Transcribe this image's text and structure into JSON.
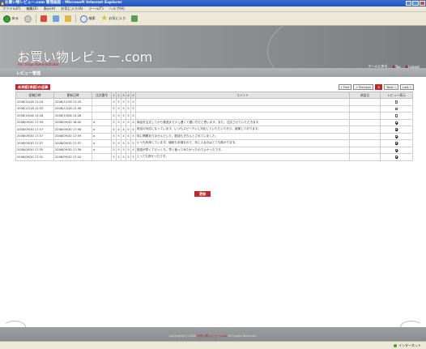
{
  "window": {
    "title": "お買い物レビュー.com 管理画面 - Microsoft Internet Explorer"
  },
  "menu": [
    "ファイル(F)",
    "編集(E)",
    "表示(V)",
    "お気に入り(A)",
    "ツール(T)",
    "ヘルプ(H)"
  ],
  "toolbar": {
    "back_label": "戻る",
    "search_label": "検索",
    "favorites_label": "お気に入り"
  },
  "site": {
    "name": "お買い物レビュー.com",
    "sub": "For Shop Administrator"
  },
  "nav": {
    "home_label": "ホームに戻る",
    "top_label": "Top",
    "logout_label": "Logout"
  },
  "section": {
    "title": "レビュー管理"
  },
  "actions": {
    "subtitle": "未承認(承認)の返事",
    "submit_label": "更新"
  },
  "pager": {
    "first": "« First",
    "prev": "« Previous",
    "current": "1",
    "next": "Next »",
    "last": "Last »"
  },
  "table": {
    "headers": [
      "投稿日時",
      "更新日時",
      "注文番号",
      "1",
      "2",
      "3",
      "4",
      "5",
      "コメント",
      "承認日",
      "レビュー表示"
    ],
    "rows": [
      {
        "posted": "2008/12/26 11:16",
        "updated": "2008/12/26 11:20",
        "order": "",
        "r1": "5",
        "r2": "5",
        "r3": "5",
        "r4": "5",
        "r5": "5",
        "comment": "",
        "approved": "",
        "show": false
      },
      {
        "posted": "2008/12/18 12:52",
        "updated": "2008/12/18 12:56",
        "order": "",
        "r1": "5",
        "r2": "5",
        "r3": "5",
        "r4": "5",
        "r5": "5",
        "comment": "",
        "approved": "",
        "show": false
      },
      {
        "posted": "2008/10/08 13:28",
        "updated": "2008/10/08 13:28",
        "order": "",
        "r1": "5",
        "r2": "5",
        "r3": "5",
        "r4": "5",
        "r5": "5",
        "comment": "",
        "approved": "",
        "show": false
      },
      {
        "posted": "2008/09/30 17:59",
        "updated": "2008/09/30 18:00",
        "order": "a",
        "r1": "5",
        "r2": "5",
        "r3": "5",
        "r4": "5",
        "r5": "4",
        "comment": "商品を注文してから発送まで少し遅くて遅い方だと思います。また、注文させていただきます。",
        "approved": "",
        "show": true
      },
      {
        "posted": "2008/09/30 17:57",
        "updated": "2008/09/30 17:58",
        "order": "a",
        "r1": "4",
        "r2": "4",
        "r3": "4",
        "r4": "5",
        "r5": "4",
        "comment": "来店の対応になっています。いつもスピーディに対応していただいており、感謝しております。",
        "approved": "",
        "show": true
      },
      {
        "posted": "2008/09/30 17:57",
        "updated": "2008/09/30 17:59",
        "order": "a",
        "r1": "5",
        "r2": "5",
        "r3": "4",
        "r4": "4",
        "r5": "5",
        "comment": "特に問題ありませんでした。配送もきちんとされていました。",
        "approved": "",
        "show": true
      },
      {
        "posted": "2008/09/30 17:57",
        "updated": "2008/09/30 17:57",
        "order": "a",
        "r1": "5",
        "r2": "5",
        "r3": "5",
        "r4": "5",
        "r5": "5",
        "comment": "いつも利用しています。値段も手頃なので、手に入るのはとても助かります。",
        "approved": "",
        "show": true
      },
      {
        "posted": "2008/09/30 17:55",
        "updated": "2008/09/30 17:56",
        "order": "a",
        "r1": "5",
        "r2": "5",
        "r3": "5",
        "r4": "5",
        "r5": "4",
        "comment": "配送が早くてびっくり。早く使ってみたかったのでよかったです。",
        "approved": "",
        "show": true
      },
      {
        "posted": "2008/09/30 17:41",
        "updated": "2008/09/30 17:42",
        "order": "",
        "r1": "5",
        "r2": "5",
        "r3": "5",
        "r4": "5",
        "r5": "5",
        "comment": "とっても良かったです。",
        "approved": "",
        "show": true
      }
    ]
  },
  "footer": {
    "copy_prefix": "Copyright(C) 2008",
    "copy_brand": "お買い物レビュー.com",
    "copy_suffix": "All Rights Reserved."
  },
  "status": {
    "left": "",
    "zone": "インターネット"
  }
}
